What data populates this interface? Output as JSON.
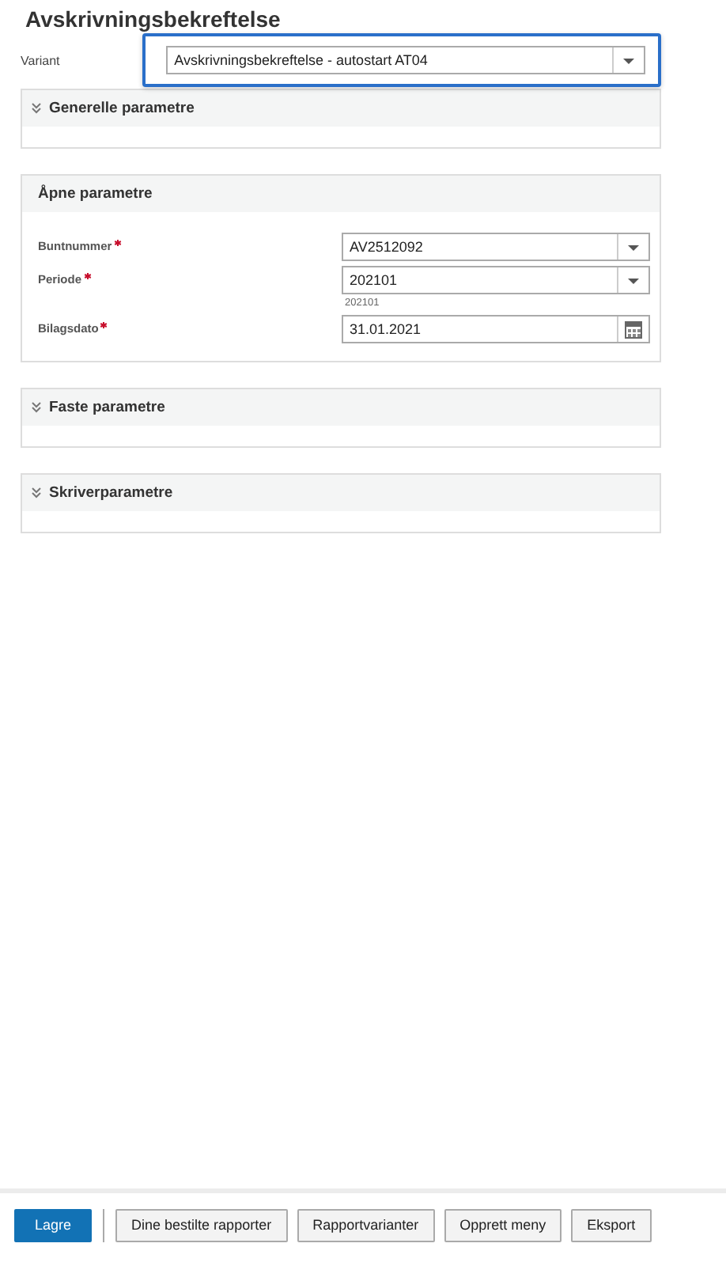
{
  "title": "Avskrivningsbekreftelse",
  "variant": {
    "label": "Variant",
    "value": "Avskrivningsbekreftelse - autostart AT04",
    "focused": true
  },
  "panels": [
    {
      "title": "Generelle parametre",
      "expanded": false
    },
    {
      "title": "Åpne parametre",
      "expanded": true,
      "fields": [
        {
          "label": "Buntnummer",
          "required": true,
          "kind": "select",
          "value": "AV2512092"
        },
        {
          "label": "Periode",
          "required": true,
          "kind": "select",
          "value": "202101",
          "hint": "202101"
        },
        {
          "label": "Bilagsdato",
          "required": true,
          "kind": "date",
          "value": "31.01.2021"
        }
      ]
    },
    {
      "title": "Faste parametre",
      "expanded": false
    },
    {
      "title": "Skriverparametre",
      "expanded": false
    }
  ],
  "buttons": [
    {
      "label": "Lagre",
      "primary": true
    },
    {
      "label": "Dine bestilte rapporter",
      "primary": false
    },
    {
      "label": "Rapportvarianter",
      "primary": false
    },
    {
      "label": "Opprett meny",
      "primary": false
    },
    {
      "label": "Eksport",
      "primary": false
    }
  ]
}
